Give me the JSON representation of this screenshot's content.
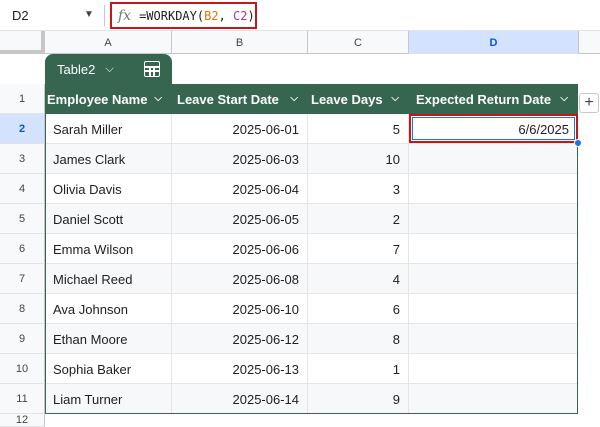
{
  "namebox": {
    "value": "D2"
  },
  "formula": {
    "prefix": "=WORKDAY(",
    "ref1": "B2",
    "sep": ", ",
    "ref2": "C2",
    "suffix": ")"
  },
  "columns": [
    "A",
    "B",
    "C",
    "D"
  ],
  "rows": [
    "1",
    "2",
    "3",
    "4",
    "5",
    "6",
    "7",
    "8",
    "9",
    "10",
    "11",
    "12"
  ],
  "table": {
    "name": "Table2",
    "headers": [
      "Employee Name",
      "Leave Start Date",
      "Leave Days",
      "Expected Return Date"
    ],
    "data": [
      [
        "Sarah Miller",
        "2025-06-01",
        "5",
        "6/6/2025"
      ],
      [
        "James Clark",
        "2025-06-03",
        "10",
        ""
      ],
      [
        "Olivia Davis",
        "2025-06-04",
        "3",
        ""
      ],
      [
        "Daniel Scott",
        "2025-06-05",
        "2",
        ""
      ],
      [
        "Emma Wilson",
        "2025-06-06",
        "7",
        ""
      ],
      [
        "Michael Reed",
        "2025-06-08",
        "4",
        ""
      ],
      [
        "Ava Johnson",
        "2025-06-10",
        "6",
        ""
      ],
      [
        "Ethan Moore",
        "2025-06-12",
        "8",
        ""
      ],
      [
        "Sophia Baker",
        "2025-06-13",
        "1",
        ""
      ],
      [
        "Liam Turner",
        "2025-06-14",
        "9",
        ""
      ]
    ]
  },
  "colors": {
    "table_header": "#376650",
    "selection": "#c5161d",
    "active_header": "#d3e3fd"
  }
}
